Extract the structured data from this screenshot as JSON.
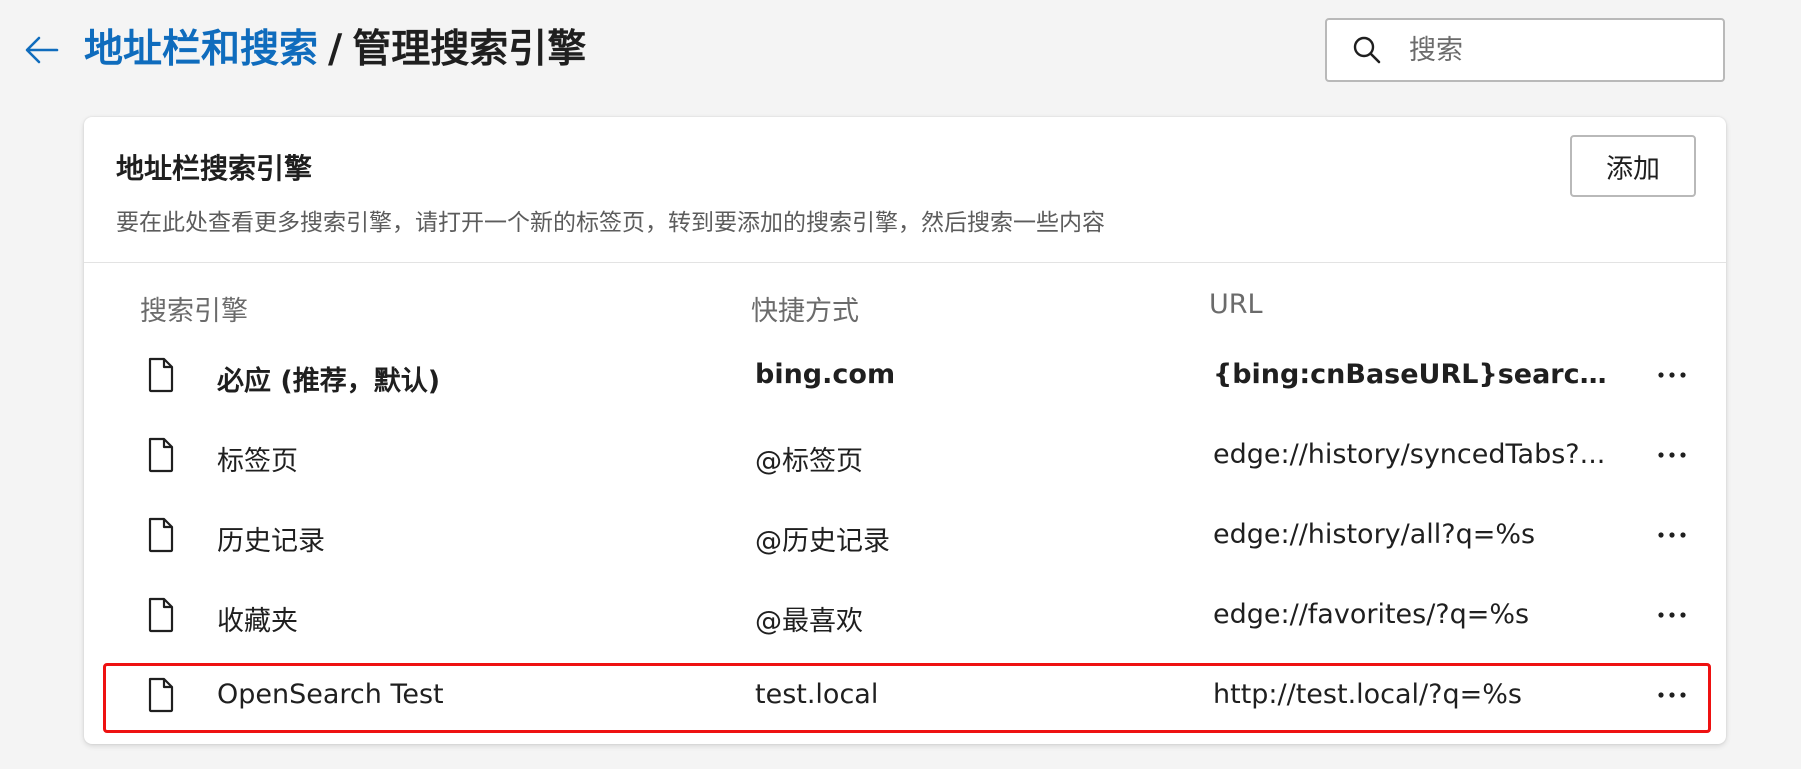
{
  "header": {
    "back_icon": "arrow-left-icon",
    "breadcrumb_parent": "地址栏和搜索",
    "breadcrumb_separator": "/",
    "breadcrumb_current": "管理搜索引擎",
    "accent_color": "#0f6cbd"
  },
  "search": {
    "icon": "search-icon",
    "placeholder": "搜索"
  },
  "section": {
    "title": "地址栏搜索引擎",
    "description": "要在此处查看更多搜索引擎，请打开一个新的标签页，转到要添加的搜索引擎，然后搜索一些内容",
    "add_button_label": "添加"
  },
  "table": {
    "columns": [
      "搜索引擎",
      "快捷方式",
      "URL"
    ],
    "row_icon": "document-icon",
    "more_icon": "more-horizontal-icon",
    "rows": [
      {
        "name": "必应 (推荐，默认)",
        "keyword": "bing.com",
        "url": "{bing:cnBaseURL}search?q...",
        "bold": true
      },
      {
        "name": "标签页",
        "keyword": "@标签页",
        "url": "edge://history/syncedTabs?...",
        "bold": false
      },
      {
        "name": "历史记录",
        "keyword": "@历史记录",
        "url": "edge://history/all?q=%s",
        "bold": false
      },
      {
        "name": "收藏夹",
        "keyword": "@最喜欢",
        "url": "edge://favorites/?q=%s",
        "bold": false
      },
      {
        "name": "OpenSearch Test",
        "keyword": "test.local",
        "url": "http://test.local/?q=%s",
        "bold": false
      }
    ]
  },
  "annotation": {
    "highlight_color": "#ee1111",
    "highlighted_row": 4
  }
}
